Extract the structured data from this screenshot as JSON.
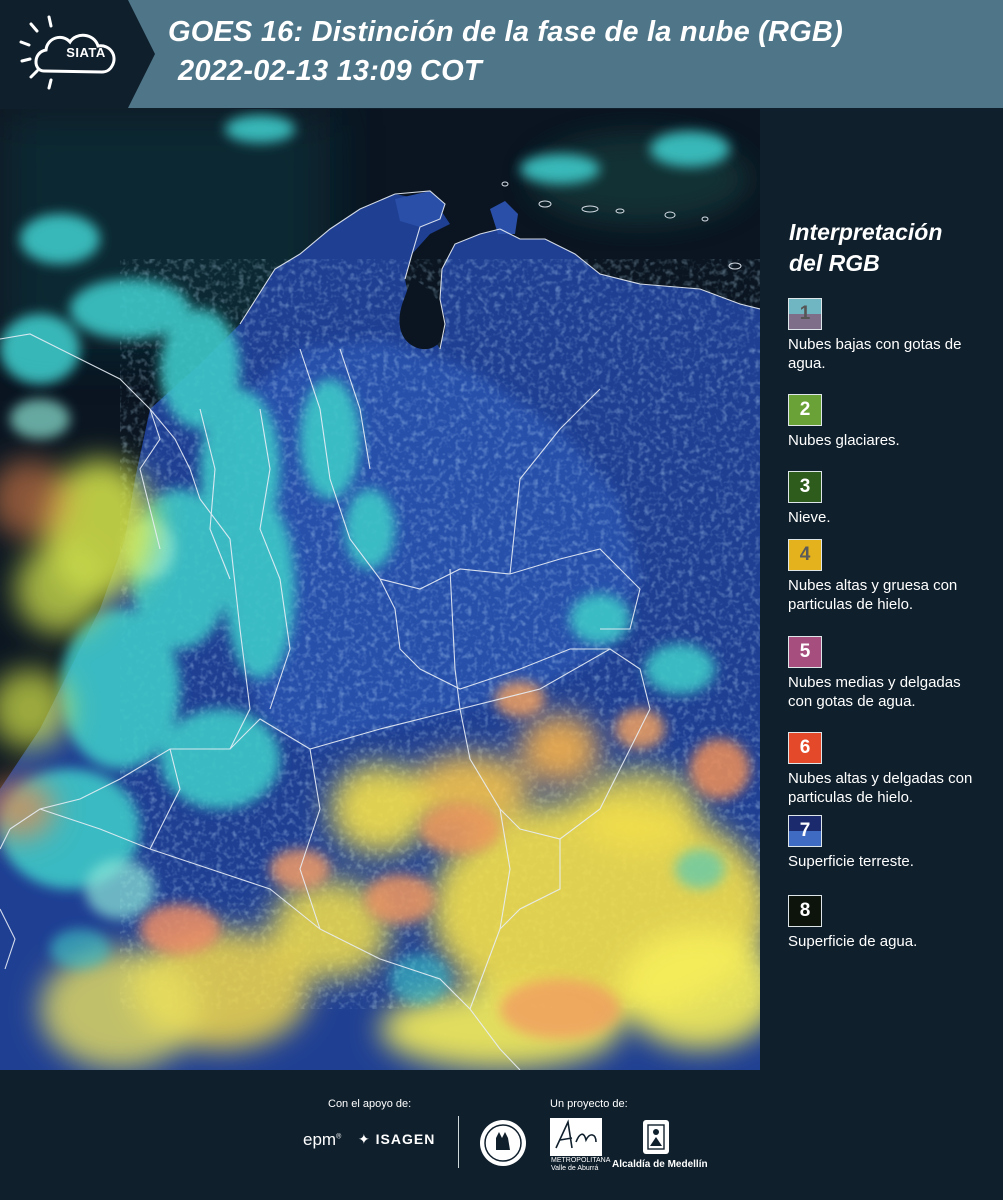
{
  "header": {
    "logo_text": "SIATA",
    "title_line1": "GOES 16: Distinción de la fase de la nube (RGB)",
    "title_line2": "2022-02-13 13:09 COT"
  },
  "legend": {
    "title_line1": "Interpretación",
    "title_line2": "del RGB",
    "items": [
      {
        "number": "1",
        "label": "Nubes bajas con gotas de agua.",
        "color_top": "#6fb6c2",
        "color_bottom": "#7e6e8a",
        "number_color": "#555555"
      },
      {
        "number": "2",
        "label": "Nubes glaciares.",
        "color_top": "#6ba237",
        "color_bottom": "#6ba237",
        "number_color": "#ffffff"
      },
      {
        "number": "3",
        "label": "Nieve.",
        "color_top": "#2e5c1c",
        "color_bottom": "#2e5c1c",
        "number_color": "#ffffff"
      },
      {
        "number": "4",
        "label": "Nubes altas y gruesa con particulas de hielo.",
        "color_top": "#e3b21c",
        "color_bottom": "#e3b21c",
        "number_color": "#5a5a5a"
      },
      {
        "number": "5",
        "label": "Nubes medias y delgadas con gotas de agua.",
        "color_top": "#a64f7e",
        "color_bottom": "#a64f7e",
        "number_color": "#ffffff"
      },
      {
        "number": "6",
        "label": "Nubes altas y delgadas con particulas de hielo.",
        "color_top": "#e4492a",
        "color_bottom": "#e4492a",
        "number_color": "#ffffff"
      },
      {
        "number": "7",
        "label": "Superficie terreste.",
        "color_top": "#1a2a6c",
        "color_bottom": "#3f6bc2",
        "number_color": "#ffffff"
      },
      {
        "number": "8",
        "label": "Superficie de agua.",
        "color_top": "#0c140c",
        "color_bottom": "#0c140c",
        "number_color": "#ffffff"
      }
    ]
  },
  "footer": {
    "support_label": "Con el apoyo de:",
    "project_label": "Un proyecto de:",
    "epm": "epm",
    "isagen": "ISAGEN",
    "area_metro": "Área",
    "area_metro_sub1": "METROPOLITANA",
    "area_metro_sub2": "Valle de Aburrá",
    "alcaldia": "Alcaldía de Medellín"
  },
  "colors": {
    "header_bg": "#4f7688",
    "page_bg": "#0f1f2c",
    "ocean": "#0a1521",
    "land": "#1c3d8c",
    "cloud_cyan": "#3ec8c8",
    "cloud_yellow": "#f4e04a",
    "cloud_orange": "#e98a4c"
  }
}
